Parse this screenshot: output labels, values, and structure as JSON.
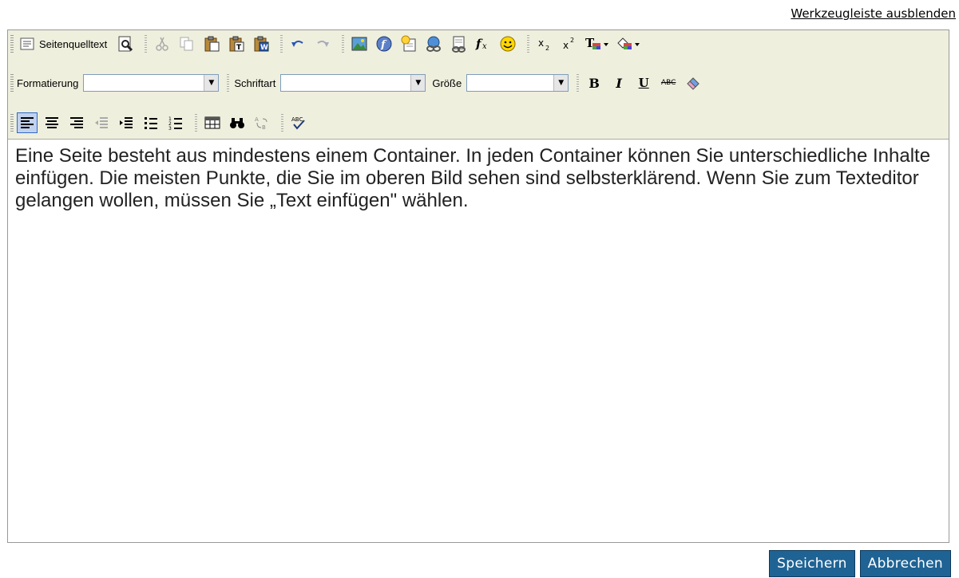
{
  "top_link": "Werkzeugleiste ausblenden",
  "toolbar": {
    "source_label": "Seitenquelltext",
    "format_label": "Formatierung",
    "font_label": "Schriftart",
    "size_label": "Größe",
    "bold": "B",
    "italic": "I",
    "underline": "U",
    "strike": "ABC",
    "format_value": "",
    "font_value": "",
    "size_value": ""
  },
  "content": {
    "text": "Eine Seite besteht aus mindestens einem Container. In jeden Container können Sie unterschiedliche Inhalte einfügen. Die meisten Punkte, die Sie im oberen Bild sehen sind selbsterklärend. Wenn Sie zum Texteditor gelangen wollen, müssen Sie „Text einfügen\" wählen."
  },
  "buttons": {
    "save": "Speichern",
    "cancel": "Abbrechen"
  },
  "colors": {
    "toolbar_bg": "#efefde",
    "button_blue": "#1f6394"
  }
}
